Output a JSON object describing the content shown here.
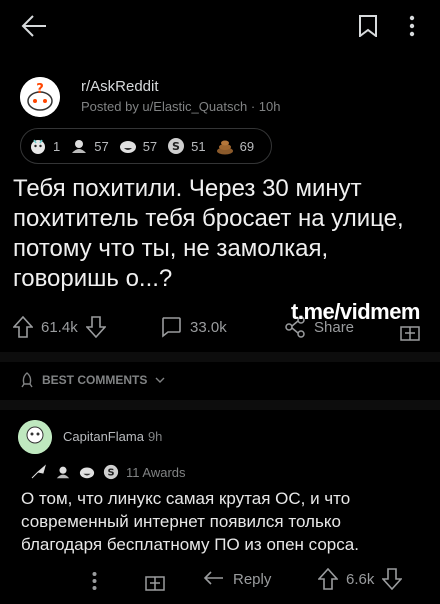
{
  "post": {
    "subreddit": "r/AskReddit",
    "posted_by": "Posted by u/Elastic_Quatsch · 10h",
    "awards": [
      {
        "icon": "wholesome-icon",
        "count": "1"
      },
      {
        "icon": "hugz-icon",
        "count": "57"
      },
      {
        "icon": "haha-icon",
        "count": "57"
      },
      {
        "icon": "silver-icon",
        "count": "51"
      },
      {
        "icon": "poop-icon",
        "count": "69"
      }
    ],
    "title": "Тебя похитили. Через 30 минут похититель тебя бросает на улице, потому что ты, не замолкая, говоришь о...?",
    "upvotes": "61.4k",
    "comments": "33.0k",
    "share_label": "Share"
  },
  "watermark": "t.me/vidmem",
  "sort": {
    "label": "BEST COMMENTS"
  },
  "comment": {
    "user": "CapitanFlama",
    "time": "9h",
    "awards_label": "11 Awards",
    "text": "О том, что линукс самая крутая ОС, и что современный интернет появился только благодаря бесплатному ПО из опен сорса.",
    "reply_label": "Reply",
    "votes": "6.6k"
  },
  "colors": {
    "background": "#000000",
    "text": "#d7dadc",
    "muted": "#818384"
  }
}
